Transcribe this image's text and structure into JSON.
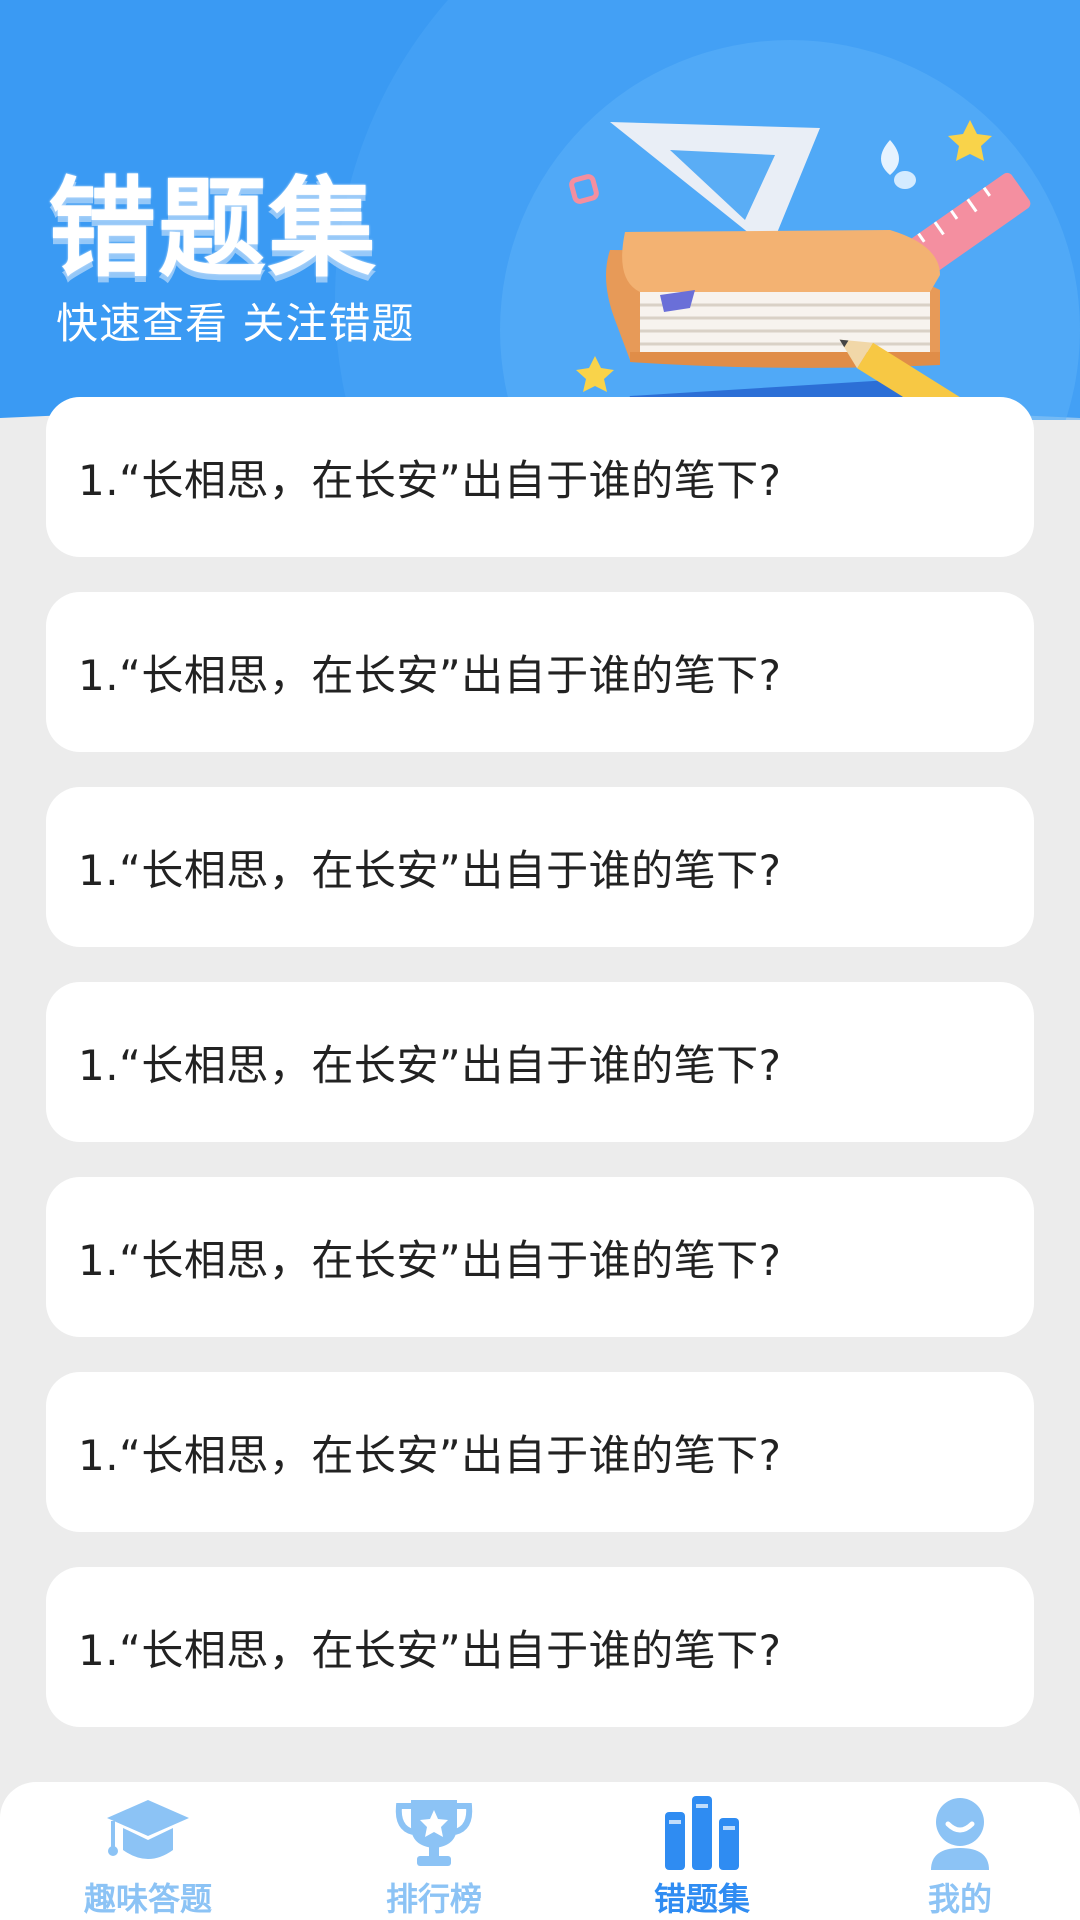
{
  "colors": {
    "header_blue": "#3a9af3",
    "accent_blue": "#2f8cf2",
    "inactive_tab": "#8cc3f5",
    "page_bg": "#ececec",
    "card_bg": "#ffffff"
  },
  "header": {
    "title": "错题集",
    "subtitle": "快速查看 关注错题",
    "illustration": "book-ruler-pencil-illustration"
  },
  "questions": [
    {
      "text": "1.“长相思，在长安”出自于谁的笔下?"
    },
    {
      "text": "1.“长相思，在长安”出自于谁的笔下?"
    },
    {
      "text": "1.“长相思，在长安”出自于谁的笔下?"
    },
    {
      "text": "1.“长相思，在长安”出自于谁的笔下?"
    },
    {
      "text": "1.“长相思，在长安”出自于谁的笔下?"
    },
    {
      "text": "1.“长相思，在长安”出自于谁的笔下?"
    },
    {
      "text": "1.“长相思，在长安”出自于谁的笔下?"
    }
  ],
  "bottom_nav": {
    "active_index": 2,
    "items": [
      {
        "label": "趣味答题",
        "icon": "graduation-cap-icon"
      },
      {
        "label": "排行榜",
        "icon": "trophy-icon"
      },
      {
        "label": "错题集",
        "icon": "books-icon"
      },
      {
        "label": "我的",
        "icon": "user-icon"
      }
    ]
  }
}
